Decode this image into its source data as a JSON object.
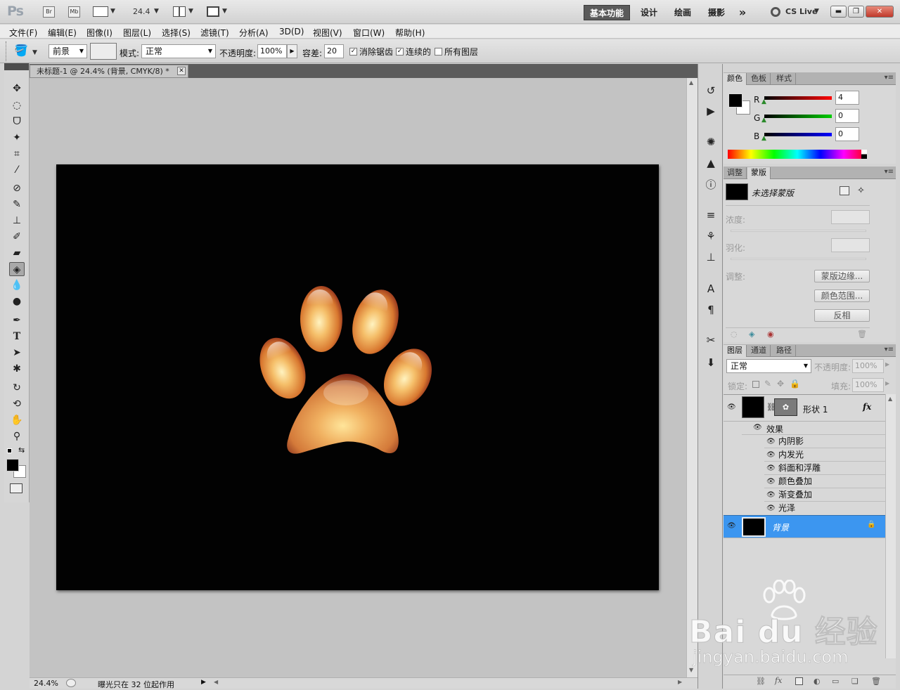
{
  "appbar": {
    "logo": "Ps",
    "br": "Br",
    "mb": "Mb",
    "zoom": "24.4",
    "workspaces": [
      "基本功能",
      "设计",
      "绘画",
      "摄影"
    ],
    "more": "»",
    "cslive": "CS Live",
    "win_min": "▬",
    "win_restore": "❐",
    "win_close": "✕"
  },
  "menu": [
    "文件(F)",
    "编辑(E)",
    "图像(I)",
    "图层(L)",
    "选择(S)",
    "滤镜(T)",
    "分析(A)",
    "3D(D)",
    "视图(V)",
    "窗口(W)",
    "帮助(H)"
  ],
  "options": {
    "fill_source": "前景",
    "mode_label": "模式:",
    "mode_value": "正常",
    "opacity_label": "不透明度:",
    "opacity_value": "100%",
    "tolerance_label": "容差:",
    "tolerance_value": "20",
    "antialias_label": "消除锯齿",
    "contiguous_label": "连续的",
    "all_layers_label": "所有图层"
  },
  "document": {
    "tab_title": "未标题-1 @ 24.4% (背景, CMYK/8) *"
  },
  "status": {
    "zoom": "24.4%",
    "message": "曝光只在 32 位起作用"
  },
  "color_panel": {
    "tabs": [
      "颜色",
      "色板",
      "样式"
    ],
    "r_label": "R",
    "g_label": "G",
    "b_label": "B",
    "r_value": "4",
    "g_value": "0",
    "b_value": "0"
  },
  "masks_panel": {
    "tabs": [
      "调整",
      "蒙版"
    ],
    "no_mask": "未选择蒙版",
    "density_label": "浓度:",
    "feather_label": "羽化:",
    "refine_label": "调整:",
    "mask_edge_btn": "蒙版边缘...",
    "color_range_btn": "颜色范围...",
    "invert_btn": "反相"
  },
  "layers_panel": {
    "tabs": [
      "图层",
      "通道",
      "路径"
    ],
    "blend_mode": "正常",
    "opacity_label": "不透明度:",
    "opacity_value": "100%",
    "lock_label": "锁定:",
    "fill_label": "填充:",
    "fill_value": "100%",
    "shape_layer_name": "形状 1",
    "fx": "fx",
    "effects_label": "效果",
    "effects": [
      "内阴影",
      "内发光",
      "斜面和浮雕",
      "颜色叠加",
      "渐变叠加",
      "光泽"
    ],
    "background_name": "背景"
  },
  "watermark": {
    "brand": "Bai du 经验",
    "url": "jingyan.baidu.com"
  }
}
